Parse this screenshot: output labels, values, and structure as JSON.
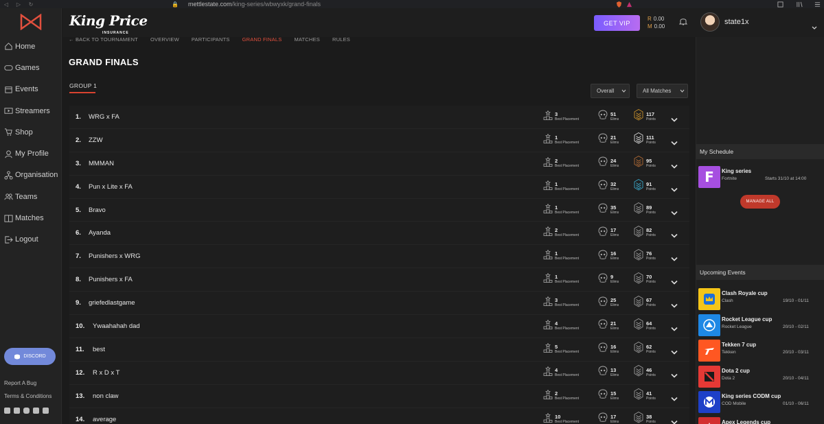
{
  "browser": {
    "url_domain": "mettlestate.com",
    "url_path": "/king-series/wbwyxk/grand-finals"
  },
  "sidebar": {
    "items": [
      {
        "label": "Home",
        "icon": "home-icon"
      },
      {
        "label": "Games",
        "icon": "gamepad-icon"
      },
      {
        "label": "Events",
        "icon": "calendar-icon"
      },
      {
        "label": "Streamers",
        "icon": "video-icon"
      },
      {
        "label": "Shop",
        "icon": "cart-icon"
      },
      {
        "label": "My Profile",
        "icon": "user-icon"
      },
      {
        "label": "Organisation",
        "icon": "organisation-icon"
      },
      {
        "label": "Teams",
        "icon": "team-icon"
      },
      {
        "label": "Matches",
        "icon": "matches-icon"
      },
      {
        "label": "Logout",
        "icon": "logout-icon"
      }
    ],
    "discord_label": "DISCORD",
    "report_bug": "Report A Bug",
    "terms": "Terms & Conditions"
  },
  "header": {
    "brand": "King Price",
    "brand_sub": "INSURANCE",
    "vip_label": "GET VIP",
    "balance_r": "0.00",
    "balance_m": "0.00",
    "username": "state1x",
    "accent": "#e2503e",
    "vip_gradient": [
      "#7a5cff",
      "#b86cf0"
    ]
  },
  "subnav": {
    "back": "← BACK TO TOURNAMENT",
    "tabs": [
      "OVERVIEW",
      "PARTICIPANTS",
      "GRAND FINALS",
      "MATCHES",
      "RULES"
    ],
    "active_tab": "GRAND FINALS"
  },
  "main": {
    "title": "GRAND FINALS",
    "group_tab": "GROUP 1",
    "filter_overall": "Overall",
    "filter_matches": "All Matches",
    "labels": {
      "placement": "Best Placement",
      "elims": "Elims",
      "points": "Points"
    }
  },
  "standings": [
    {
      "rank": "1.",
      "team": "WRG x FA",
      "placement": "3",
      "elims": "51",
      "points": "117",
      "medal": "gold"
    },
    {
      "rank": "2.",
      "team": "ZZW",
      "placement": "1",
      "elims": "21",
      "points": "111",
      "medal": "silver"
    },
    {
      "rank": "3.",
      "team": "MMMAN",
      "placement": "2",
      "elims": "24",
      "points": "95",
      "medal": "bronze"
    },
    {
      "rank": "4.",
      "team": "Pun x Lite x FA",
      "placement": "1",
      "elims": "32",
      "points": "91",
      "medal": "blue"
    },
    {
      "rank": "5.",
      "team": "Bravo",
      "placement": "1",
      "elims": "35",
      "points": "89",
      "medal": "grey"
    },
    {
      "rank": "6.",
      "team": "Ayanda",
      "placement": "2",
      "elims": "17",
      "points": "82",
      "medal": "grey"
    },
    {
      "rank": "7.",
      "team": "Punishers x WRG",
      "placement": "1",
      "elims": "16",
      "points": "76",
      "medal": "grey"
    },
    {
      "rank": "8.",
      "team": "Punishers x FA",
      "placement": "1",
      "elims": "9",
      "points": "70",
      "medal": "grey"
    },
    {
      "rank": "9.",
      "team": "griefedlastgame",
      "placement": "3",
      "elims": "25",
      "points": "67",
      "medal": "grey"
    },
    {
      "rank": "10.",
      "team": "Ywaahahah dad",
      "placement": "4",
      "elims": "21",
      "points": "64",
      "medal": "grey"
    },
    {
      "rank": "11.",
      "team": "best",
      "placement": "5",
      "elims": "16",
      "points": "62",
      "medal": "grey"
    },
    {
      "rank": "12.",
      "team": "R x D x T",
      "placement": "4",
      "elims": "13",
      "points": "46",
      "medal": "grey"
    },
    {
      "rank": "13.",
      "team": "non claw",
      "placement": "2",
      "elims": "15",
      "points": "41",
      "medal": "grey"
    },
    {
      "rank": "14.",
      "team": "average",
      "placement": "10",
      "elims": "17",
      "points": "38",
      "medal": "grey"
    }
  ],
  "schedule": {
    "header": "My Schedule",
    "item": {
      "name": "King series",
      "game": "Fortnite",
      "when": "Starts 31/10 at 14:00",
      "tile_letter": "F",
      "tile_color": "#a64fe0"
    },
    "manage_label": "MANAGE ALL"
  },
  "upcoming": {
    "header": "Upcoming Events",
    "events": [
      {
        "name": "Clash Royale cup",
        "game": "Clash",
        "dates": "19/10 - 01/11",
        "color": "#f5c518",
        "icon": "crown-icon"
      },
      {
        "name": "Rocket League cup",
        "game": "Rocket League",
        "dates": "20/10 - 02/11",
        "color": "#1e88e5",
        "icon": "rocket-league-icon"
      },
      {
        "name": "Tekken 7 cup",
        "game": "Tekken",
        "dates": "20/10 - 03/11",
        "color": "#ff5722",
        "icon": "tekken-icon"
      },
      {
        "name": "Dota 2 cup",
        "game": "Dota 2",
        "dates": "20/10 - 04/11",
        "color": "#e53935",
        "icon": "dota-icon"
      },
      {
        "name": "King series CODM cup",
        "game": "COD Mobile",
        "dates": "01/10 - 06/11",
        "color": "#1e40c8",
        "icon": "codm-icon"
      },
      {
        "name": "Apex Legends cup",
        "game": "",
        "dates": "",
        "color": "#d32f2f",
        "icon": "apex-icon"
      }
    ]
  }
}
